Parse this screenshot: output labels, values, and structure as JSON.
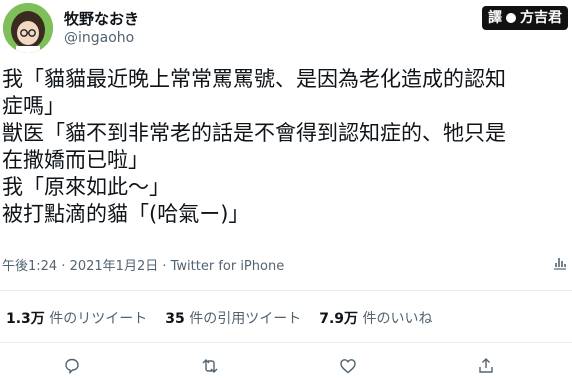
{
  "author": {
    "display_name": "牧野なおき",
    "handle": "@ingaoho"
  },
  "watermark": {
    "left": "譯",
    "right": "方吉君"
  },
  "tweet": {
    "lines": [
      "我「貓貓最近晚上常常罵罵號、是因為老化造成的認知",
      "症嗎」",
      "獣医「貓不到非常老的話是不會得到認知症的、牠只是",
      "在撒嬌而已啦」",
      "我「原來如此～」",
      "被打點滴的貓「(哈氣ー)」"
    ]
  },
  "meta": {
    "timestamp": "午後1:24 · 2021年1月2日 · Twitter for iPhone"
  },
  "stats": {
    "retweets_count": "1.3万",
    "retweets_label": "件のリツイート",
    "quotes_count": "35",
    "quotes_label": "件の引用ツイート",
    "likes_count": "7.9万",
    "likes_label": "件のいいね"
  },
  "icons": [
    "analytics-icon",
    "reply-icon",
    "retweet-icon",
    "like-icon",
    "share-icon"
  ],
  "colors": {
    "text": "#0f1419",
    "secondary": "#536471",
    "divider": "#e6ecf0"
  }
}
